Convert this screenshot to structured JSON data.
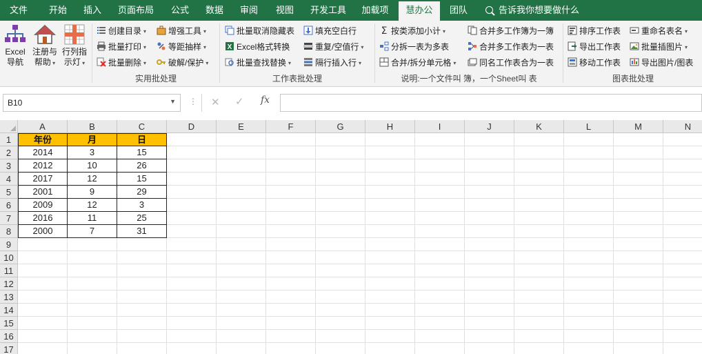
{
  "tabs": [
    "文件",
    "开始",
    "插入",
    "页面布局",
    "公式",
    "数据",
    "审阅",
    "视图",
    "开发工具",
    "加载项",
    "慧办公",
    "团队"
  ],
  "active_tab": "慧办公",
  "tell_me": "告诉我你想要做什么",
  "ribbon": {
    "nav": {
      "excel_nav": [
        "Excel",
        "导航"
      ],
      "register": [
        "注册与",
        "帮助"
      ],
      "row_col": [
        "行列指",
        "示灯"
      ]
    },
    "group1": {
      "label": "实用批处理",
      "items": [
        "创建目录",
        "批量打印",
        "批量删除",
        "增强工具",
        "等距抽样",
        "破解/保护"
      ]
    },
    "group2": {
      "label": "工作表批处理",
      "items": [
        "批量取消隐藏表",
        "Excel格式转换",
        "批量查找替换",
        "填充空白行",
        "重复/空值行",
        "隔行插入行"
      ]
    },
    "group3": {
      "label": "说明:一个文件叫 簿，一个Sheet叫 表",
      "items": [
        "按类添加小计",
        "分拆一表为多表",
        "合并/拆分单元格",
        "合并多工作簿为一簿",
        "合并多工作表为一表",
        "同名工作表合为一表"
      ]
    },
    "group4": {
      "label": "图表批处理",
      "items": [
        "排序工作表",
        "导出工作表",
        "移动工作表",
        "重命名表名",
        "批量插图片",
        "导出图片/图表"
      ]
    }
  },
  "formula_bar": {
    "name_box": "B10",
    "cancel": "✕",
    "enter": "✓",
    "fx": "fx",
    "formula": ""
  },
  "columns": [
    "A",
    "B",
    "C",
    "D",
    "E",
    "F",
    "G",
    "H",
    "I",
    "J",
    "K",
    "L",
    "M",
    "N"
  ],
  "rows": [
    "1",
    "2",
    "3",
    "4",
    "5",
    "6",
    "7",
    "8",
    "9",
    "10",
    "11",
    "12",
    "13",
    "14",
    "15",
    "16",
    "17"
  ],
  "sheet": {
    "headers": [
      "年份",
      "月",
      "日"
    ],
    "data": [
      [
        "2014",
        "3",
        "15"
      ],
      [
        "2012",
        "10",
        "26"
      ],
      [
        "2017",
        "12",
        "15"
      ],
      [
        "2001",
        "9",
        "29"
      ],
      [
        "2009",
        "12",
        "3"
      ],
      [
        "2016",
        "11",
        "25"
      ],
      [
        "2000",
        "7",
        "31"
      ]
    ]
  },
  "colors": {
    "tab_bar": "#217346",
    "header_fill": "#ffc000",
    "ribbon_bg": "#f3f3f3"
  }
}
